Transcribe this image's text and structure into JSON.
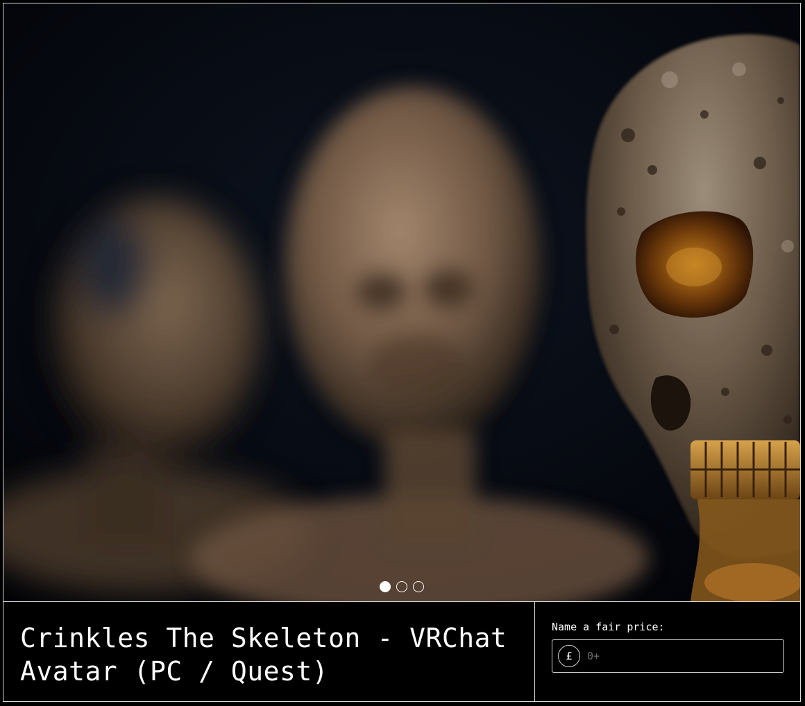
{
  "product": {
    "title": "Crinkles The Skeleton - VRChat Avatar (PC / Quest)"
  },
  "carousel": {
    "slide_count": 3,
    "active_index": 0
  },
  "pricing": {
    "label": "Name a fair price:",
    "currency_symbol": "£",
    "placeholder": "0+",
    "value": ""
  },
  "colors": {
    "background": "#000000",
    "border": "#d9d9d9",
    "text": "#ffffff",
    "placeholder": "#6e6e6e"
  }
}
